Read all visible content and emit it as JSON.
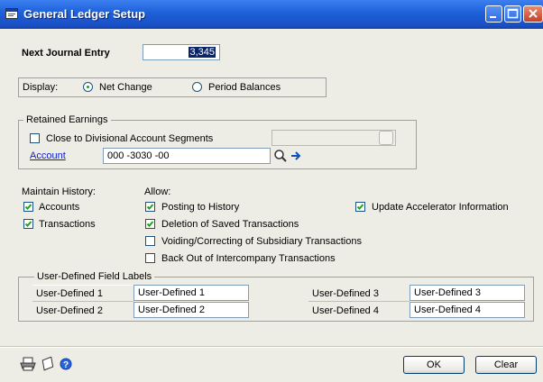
{
  "window": {
    "title": "General Ledger Setup"
  },
  "next_journal": {
    "label": "Next Journal Entry",
    "value": "3,345"
  },
  "display": {
    "label": "Display:",
    "options": [
      {
        "label": "Net Change",
        "selected": true
      },
      {
        "label": "Period Balances",
        "selected": false
      }
    ]
  },
  "retained": {
    "legend": "Retained Earnings",
    "close_label": "Close to Divisional Account Segments",
    "close_checked": false,
    "account_label": "Account",
    "account_value": "000 -3030 -00"
  },
  "maintain_history": {
    "label": "Maintain History:",
    "accounts": {
      "label": "Accounts",
      "checked": true
    },
    "transactions": {
      "label": "Transactions",
      "checked": true
    }
  },
  "allow": {
    "label": "Allow:",
    "posting": {
      "label": "Posting to History",
      "checked": true
    },
    "deletion": {
      "label": "Deletion of Saved Transactions",
      "checked": true
    },
    "voiding": {
      "label": "Voiding/Correcting of Subsidiary Transactions",
      "checked": false
    },
    "backout": {
      "label": "Back Out of Intercompany Transactions",
      "checked": false
    },
    "accelerator": {
      "label": "Update Accelerator Information",
      "checked": true
    }
  },
  "udf": {
    "legend": "User-Defined Field Labels",
    "rows": [
      {
        "label": "User-Defined 1",
        "value": "User-Defined 1"
      },
      {
        "label": "User-Defined 2",
        "value": "User-Defined 2"
      },
      {
        "label": "User-Defined 3",
        "value": "User-Defined 3"
      },
      {
        "label": "User-Defined 4",
        "value": "User-Defined 4"
      }
    ]
  },
  "footer": {
    "ok_label": "OK",
    "clear_label": "Clear"
  },
  "colors": {
    "titlebar": "#1d5fd8",
    "link": "#1020c8",
    "face": "#eeede5"
  }
}
